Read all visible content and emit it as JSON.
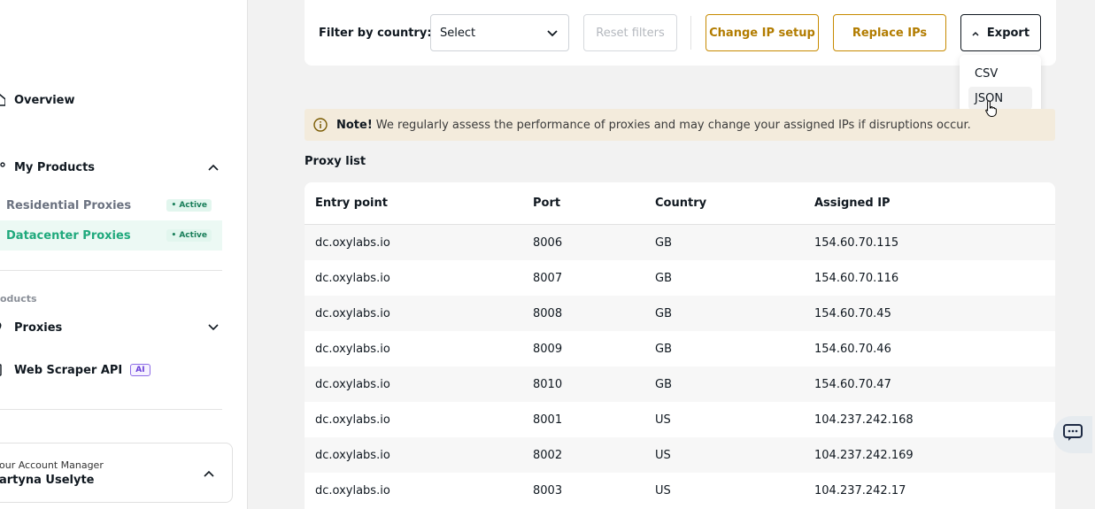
{
  "sidebar": {
    "overview": "Overview",
    "my_products": "My Products",
    "products": [
      {
        "label": "Residential Proxies",
        "badge": "• Active"
      },
      {
        "label": "Datacenter Proxies",
        "badge": "• Active"
      }
    ],
    "section_label": "oducts",
    "proxies": "Proxies",
    "web_scraper": "Web Scraper API",
    "ai_badge": "AI",
    "account_manager_label": "our Account Manager",
    "account_manager_name": "artyna Uselyte"
  },
  "filters": {
    "label": "Filter by country:",
    "select_value": "Select",
    "reset": "Reset filters",
    "change_ip": "Change IP setup",
    "replace_ips": "Replace IPs",
    "export": "Export"
  },
  "export_menu": [
    "CSV",
    "JSON"
  ],
  "note": {
    "bold": "Note!",
    "text": "We regularly assess the performance of proxies and may change your assigned IPs if disruptions occur."
  },
  "proxy_list": {
    "title": "Proxy list",
    "columns": [
      "Entry point",
      "Port",
      "Country",
      "Assigned IP"
    ],
    "rows": [
      [
        "dc.oxylabs.io",
        "8006",
        "GB",
        "154.60.70.115"
      ],
      [
        "dc.oxylabs.io",
        "8007",
        "GB",
        "154.60.70.116"
      ],
      [
        "dc.oxylabs.io",
        "8008",
        "GB",
        "154.60.70.45"
      ],
      [
        "dc.oxylabs.io",
        "8009",
        "GB",
        "154.60.70.46"
      ],
      [
        "dc.oxylabs.io",
        "8010",
        "GB",
        "154.60.70.47"
      ],
      [
        "dc.oxylabs.io",
        "8001",
        "US",
        "104.237.242.168"
      ],
      [
        "dc.oxylabs.io",
        "8002",
        "US",
        "104.237.242.169"
      ],
      [
        "dc.oxylabs.io",
        "8003",
        "US",
        "104.237.242.17"
      ]
    ]
  },
  "colors": {
    "accent_green": "#1fa97c",
    "accent_orange": "#c78a00",
    "note_bg": "#f3ebdc"
  }
}
